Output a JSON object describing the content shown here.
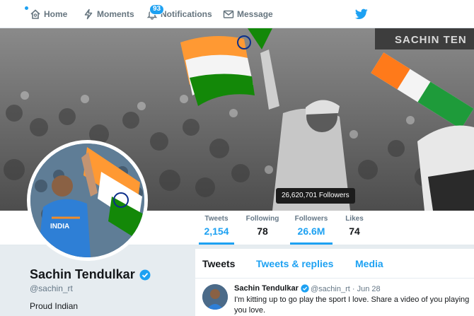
{
  "nav": {
    "home": "Home",
    "moments": "Moments",
    "notifications": "Notifications",
    "notifications_count": "93",
    "messages": "Message"
  },
  "banner": {
    "overlay_text": "SACHIN TEN",
    "followers_tooltip": "26,620,701 Followers"
  },
  "stats": [
    {
      "label": "Tweets",
      "value": "2,154"
    },
    {
      "label": "Following",
      "value": "78"
    },
    {
      "label": "Followers",
      "value": "26.6M"
    },
    {
      "label": "Likes",
      "value": "74"
    }
  ],
  "profile": {
    "name": "Sachin Tendulkar",
    "handle": "@sachin_rt",
    "bio": "Proud Indian"
  },
  "timeline": {
    "tabs": [
      "Tweets",
      "Tweets & replies",
      "Media"
    ],
    "tweet": {
      "name": "Sachin Tendulkar",
      "handle": "@sachin_rt",
      "date": "Jun 28",
      "text": "I'm kitting up to go play the sport I love. Share a video of you playing you love."
    }
  },
  "colors": {
    "accent": "#1da1f2",
    "text": "#14171a",
    "muted": "#657786"
  },
  "icons": [
    "home-icon",
    "moments-icon",
    "notifications-icon",
    "messages-icon",
    "twitter-bird-icon",
    "verified-icon"
  ]
}
